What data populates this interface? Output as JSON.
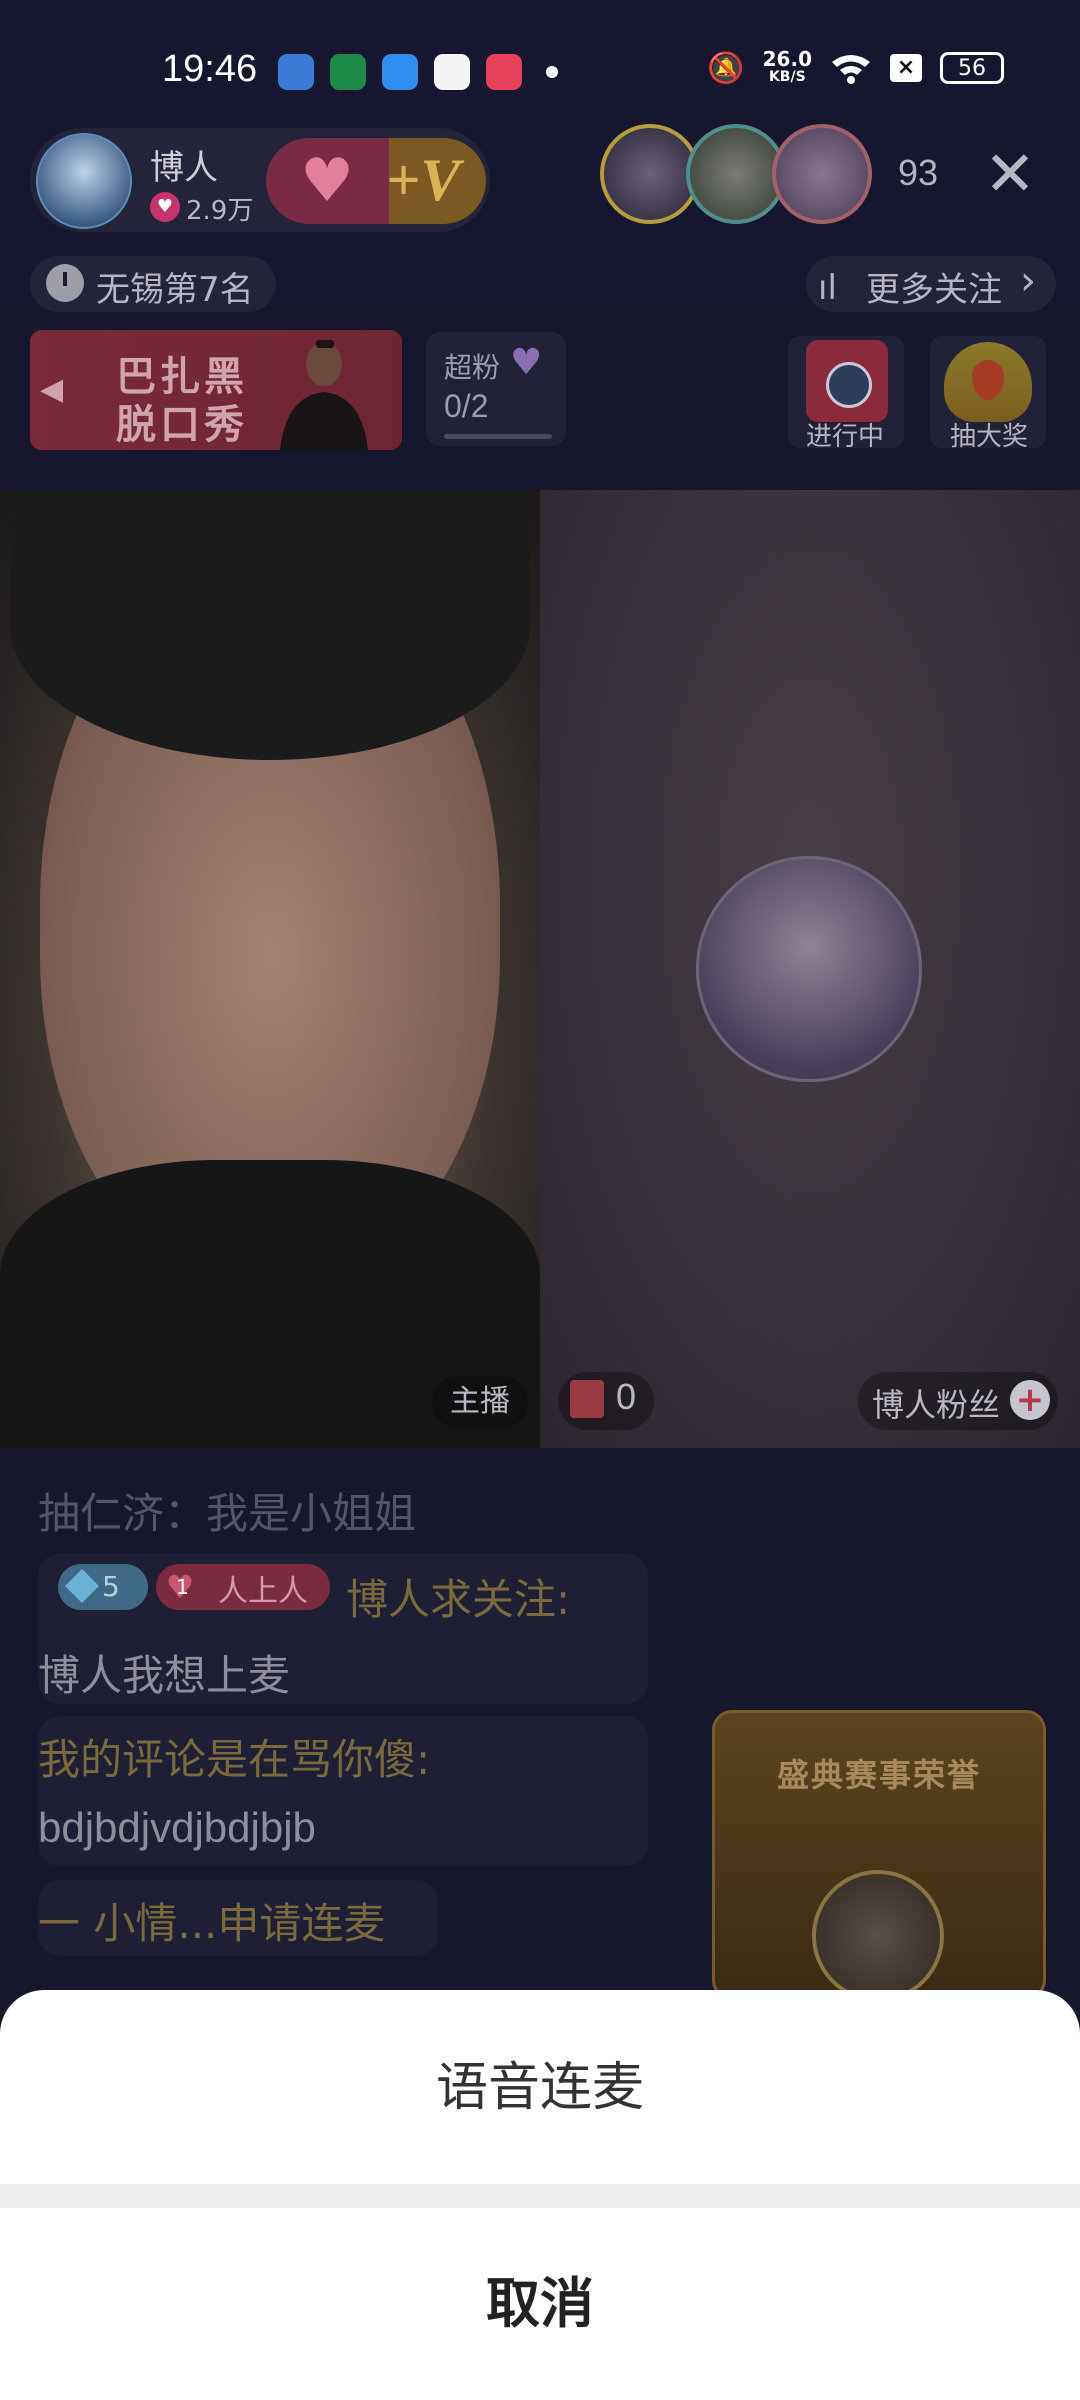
{
  "status_bar": {
    "time": "19:46",
    "speed_value": "26.0",
    "speed_unit": "KB/S",
    "battery": "56",
    "app_icons": [
      "browser-icon",
      "oppo-icon",
      "wallet-icon",
      "search-app-icon",
      "music-icon"
    ]
  },
  "header": {
    "host_name": "博人",
    "host_fans": "2.9万",
    "viewer_count": "93",
    "rank_text": "无锡第7名",
    "more_follow": "更多关注"
  },
  "activities": {
    "banner_line1": "巴扎黑",
    "banner_line2": "脱口秀",
    "superfan_label": "超粉",
    "superfan_count": "0/2",
    "ongoing_label": "进行中",
    "lottery_label": "抽大奖"
  },
  "video": {
    "host_tag": "主播",
    "gift_count": "0",
    "fan_label": "博人粉丝"
  },
  "chat": {
    "msg1_name": "抽仁济",
    "msg1_text": "我是小姐姐",
    "msg2_level": "5",
    "msg2_fan_level": "1",
    "msg2_fan_title": "人上人",
    "msg2_name": "博人求关注:",
    "msg2_text": "博人我想上麦",
    "msg3_name": "我的评论是在骂你傻:",
    "msg3_text": "bdjbdjvdjbdjbjb",
    "msg4_text": "一 小情...申请连麦"
  },
  "honor_card": {
    "title": "盛典赛事荣誉"
  },
  "action_sheet": {
    "option_voice": "语音连麦",
    "cancel": "取消"
  }
}
